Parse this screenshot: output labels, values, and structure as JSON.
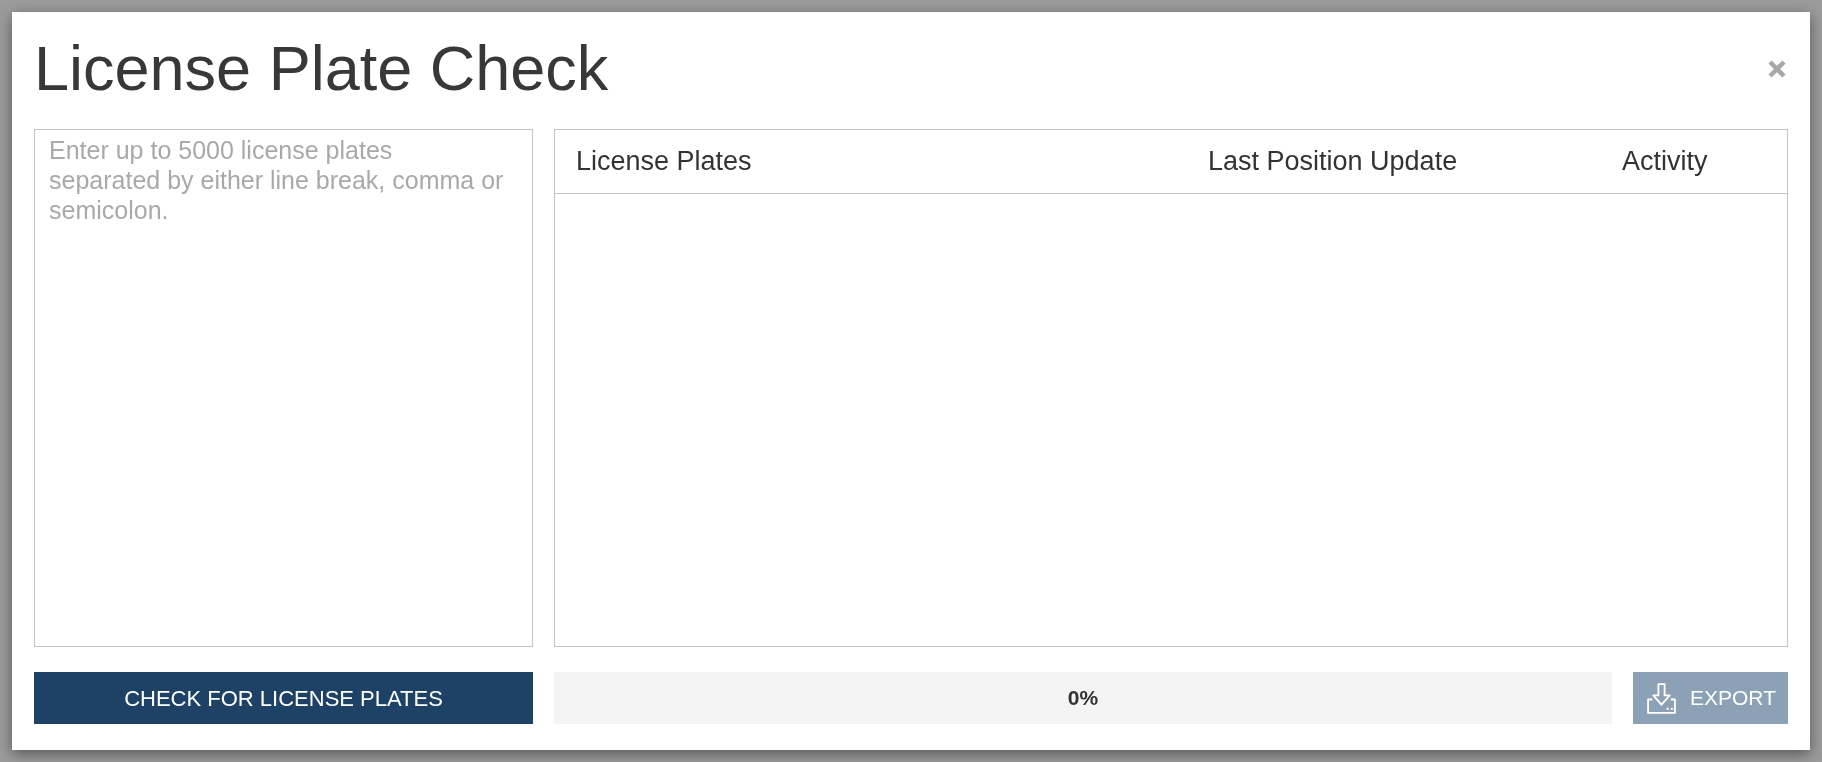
{
  "dialog": {
    "title": "License Plate Check"
  },
  "input": {
    "placeholder": "Enter up to 5000 license plates separated by either line break, comma or semicolon."
  },
  "table": {
    "columns": [
      "License Plates",
      "Last Position Update",
      "Activity"
    ]
  },
  "check_button": {
    "label": "CHECK FOR LICENSE PLATES"
  },
  "progress": {
    "level": 0,
    "reading": "0%"
  },
  "export_button": {
    "label": "EXPORT",
    "disabled": true
  }
}
